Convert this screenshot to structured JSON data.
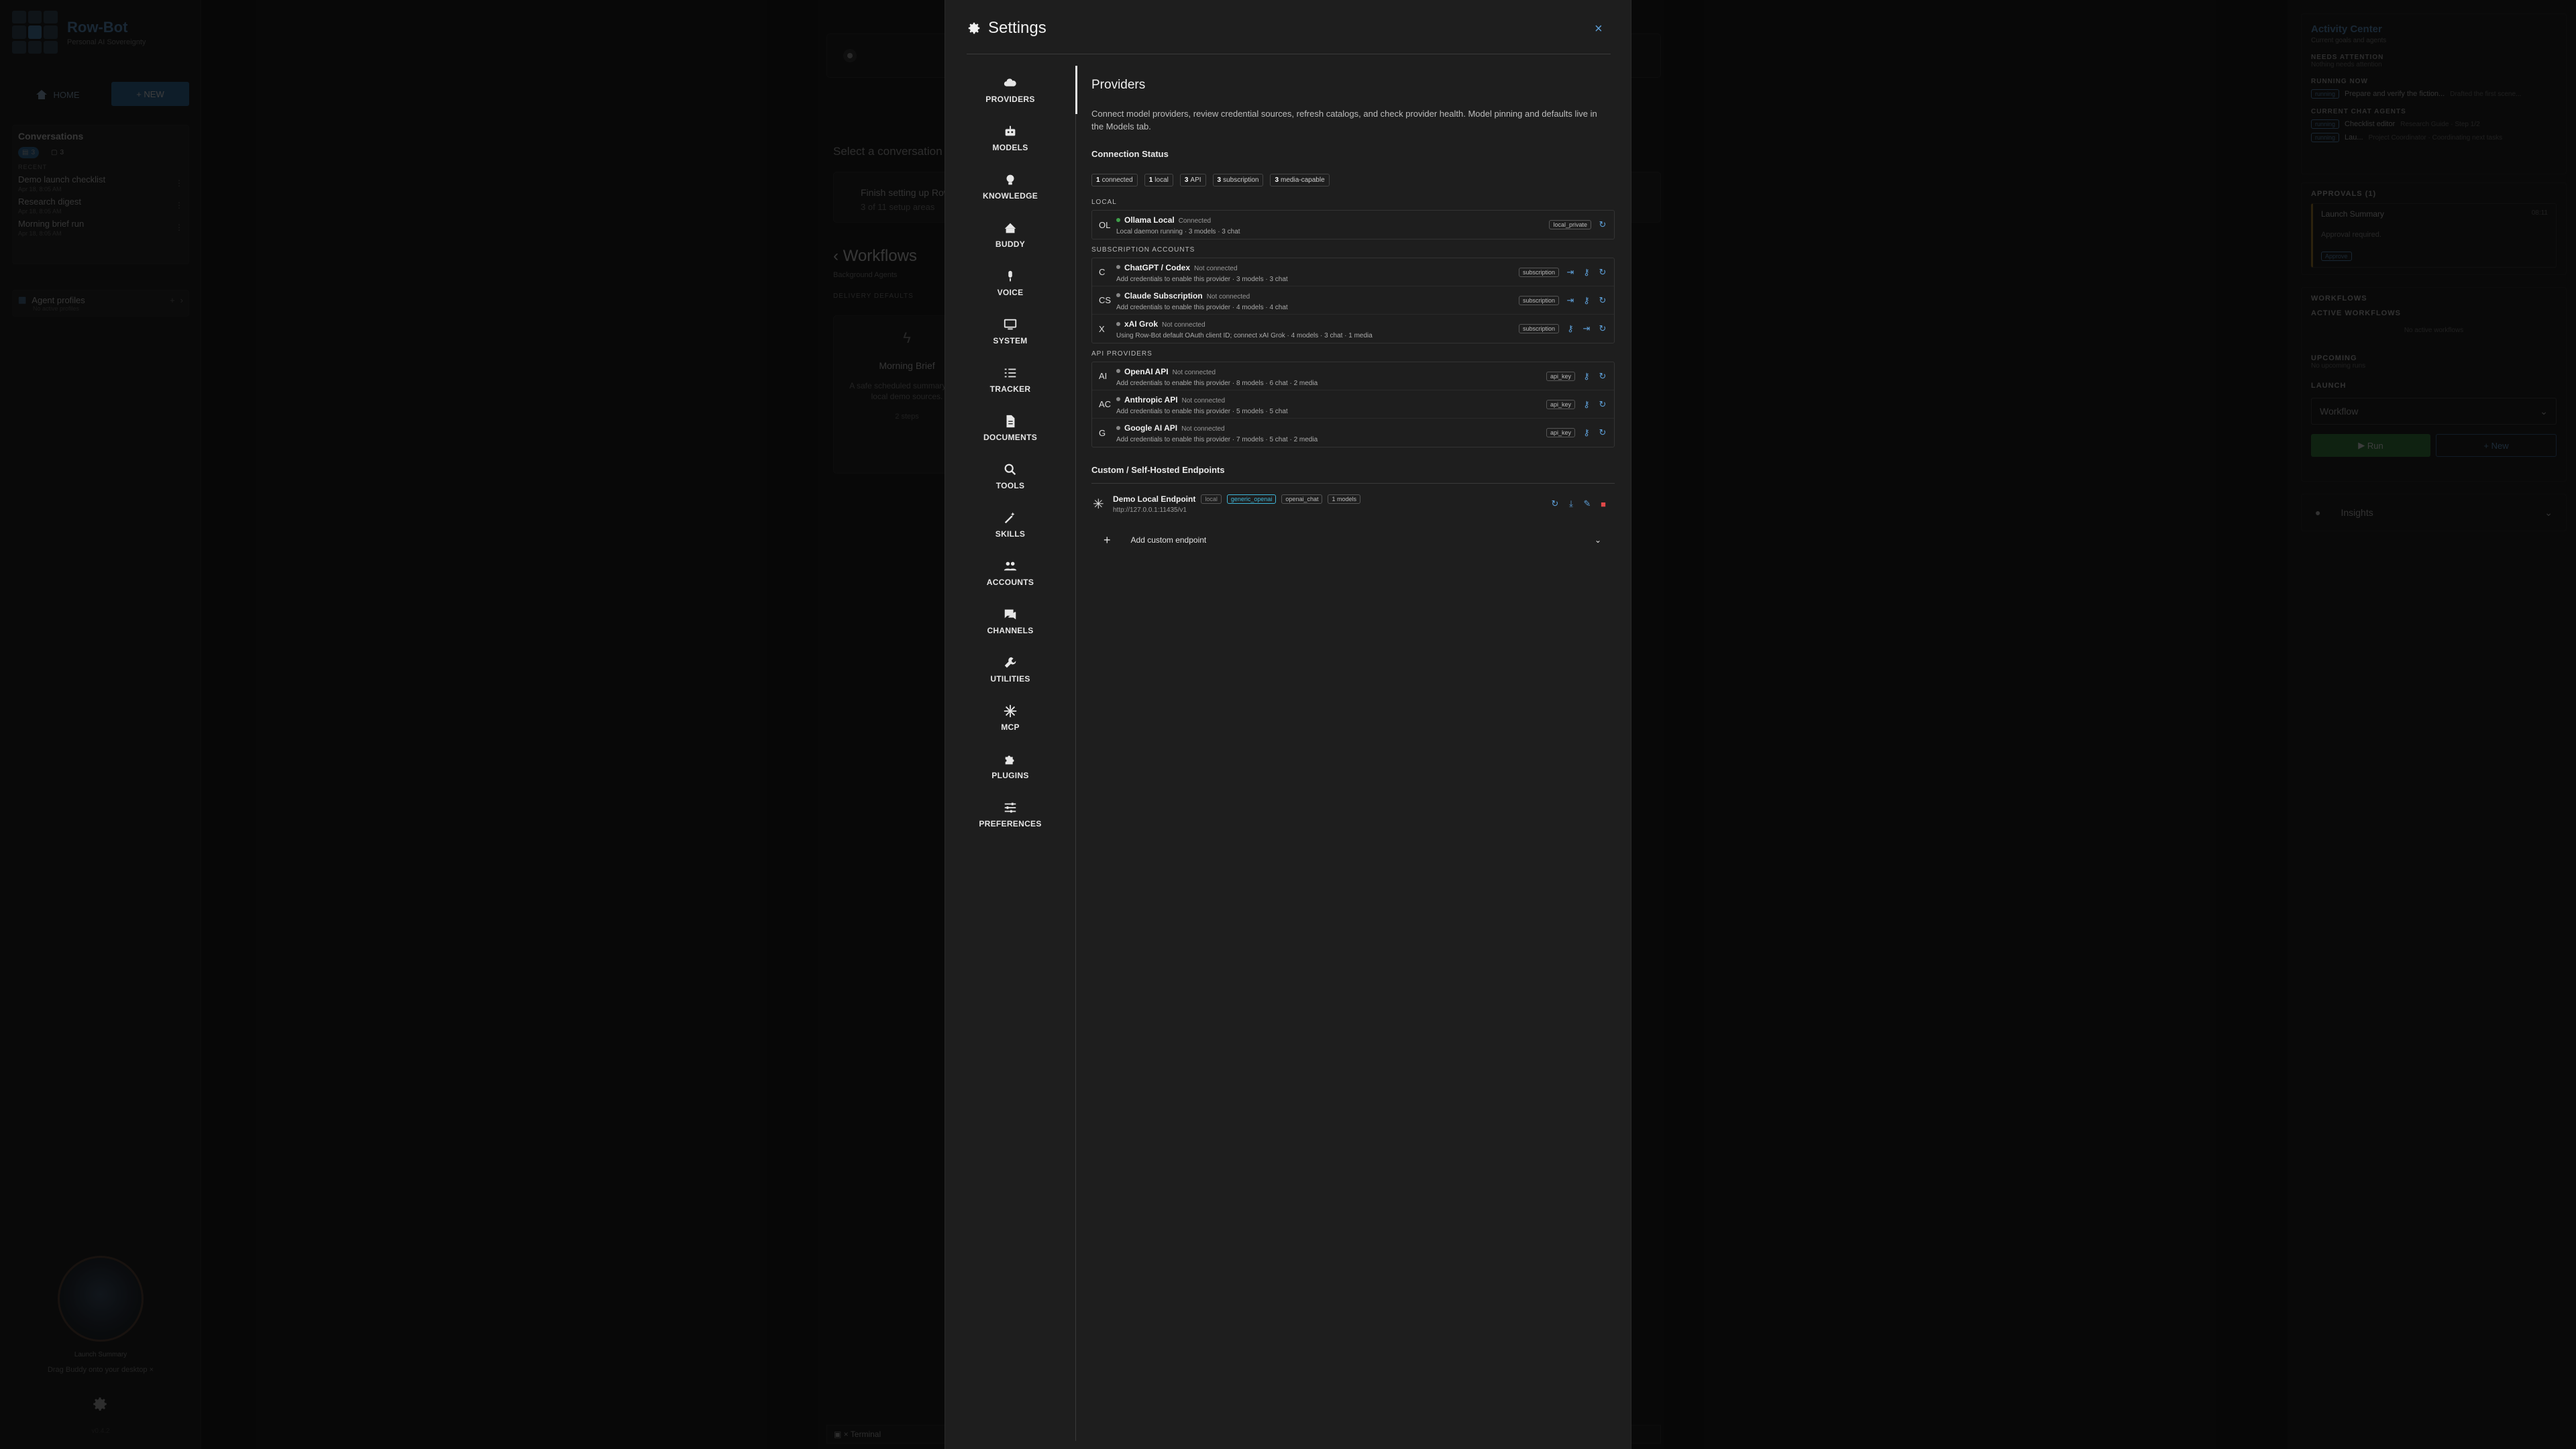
{
  "left": {
    "brand_title": "Row-Bot",
    "brand_sub": "Personal AI Sovereignty",
    "home_label": "HOME",
    "new_label": "+ NEW",
    "conversations_title": "Conversations",
    "conv_tab_count_1": "3",
    "conv_tab_count_2": "3",
    "recent_label": "RECENT",
    "conversations": [
      {
        "name": "Demo launch checklist",
        "time": "Apr 18, 8:05 AM"
      },
      {
        "name": "Research digest",
        "time": "Apr 18, 8:05 AM"
      },
      {
        "name": "Morning brief run",
        "time": "Apr 18, 8:05 AM"
      }
    ],
    "agent_profiles_title": "Agent profiles",
    "agent_profiles_sub": "No active profiles",
    "buddy_label": "Launch Summary",
    "buddy_hint": "Drag Buddy onto your desktop",
    "version": "v0.4.2"
  },
  "center": {
    "select_text": "Select a conversation",
    "setup_title": "Finish setting up Row-Bot",
    "setup_sub": "3 of 11 setup areas",
    "workflows_title": "Workflows",
    "workflows_sub": "Background Agents",
    "delivery_label": "DELIVERY DEFAULTS",
    "card_title": "Morning Brief",
    "card_desc": "A safe scheduled summary from local demo sources.",
    "card_steps": "2 steps",
    "terminal_label": "Terminal"
  },
  "right": {
    "activity_title": "Activity Center",
    "activity_sub": "Current goals and agents",
    "needs_attention": "NEEDS ATTENTION",
    "needs_attention_sub": "Nothing needs attention",
    "running_now": "RUNNING NOW",
    "running_pill": "running",
    "running_task": "Prepare and verify the fiction...",
    "running_meta": "Drafted the first scene...",
    "current_agents": "CURRENT CHAT AGENTS",
    "agents": [
      {
        "pill": "running",
        "name": "Checklist editor",
        "meta": "Research Guide · Step 1/2"
      },
      {
        "pill": "running",
        "name": "Lau...",
        "meta": "Project Coordinator · Coordinating next tasks"
      }
    ],
    "approvals_title": "APPROVALS (1)",
    "approval_name": "Launch Summary",
    "approval_time": "08:11",
    "approval_text": "Approval required.",
    "approve_label": "Approve",
    "workflows_label": "WORKFLOWS",
    "active_workflows": "ACTIVE WORKFLOWS",
    "no_active": "No active workflows",
    "upcoming_label": "UPCOMING",
    "upcoming_sub": "No upcoming runs",
    "launch_label": "LAUNCH",
    "workflow_select": "Workflow",
    "run_label": "Run",
    "new_label": "New",
    "insights_label": "Insights"
  },
  "modal": {
    "title": "Settings",
    "nav": [
      {
        "label": "PROVIDERS",
        "icon": "cloud-icon"
      },
      {
        "label": "MODELS",
        "icon": "robot-icon"
      },
      {
        "label": "KNOWLEDGE",
        "icon": "bulb-icon"
      },
      {
        "label": "BUDDY",
        "icon": "buddy-icon"
      },
      {
        "label": "VOICE",
        "icon": "mic-icon"
      },
      {
        "label": "SYSTEM",
        "icon": "monitor-icon"
      },
      {
        "label": "TRACKER",
        "icon": "checklist-icon"
      },
      {
        "label": "DOCUMENTS",
        "icon": "document-icon"
      },
      {
        "label": "TOOLS",
        "icon": "search-icon"
      },
      {
        "label": "SKILLS",
        "icon": "wand-icon"
      },
      {
        "label": "ACCOUNTS",
        "icon": "people-icon"
      },
      {
        "label": "CHANNELS",
        "icon": "chat-icon"
      },
      {
        "label": "UTILITIES",
        "icon": "wrench-icon"
      },
      {
        "label": "MCP",
        "icon": "hub-icon"
      },
      {
        "label": "PLUGINS",
        "icon": "puzzle-icon"
      },
      {
        "label": "PREFERENCES",
        "icon": "sliders-icon"
      }
    ],
    "content": {
      "title": "Providers",
      "description": "Connect model providers, review credential sources, refresh catalogs, and check provider health. Model pinning and defaults live in the Models tab.",
      "connection_status": "Connection Status",
      "chips": [
        {
          "n": "1",
          "label": "connected"
        },
        {
          "n": "1",
          "label": "local"
        },
        {
          "n": "3",
          "label": "API"
        },
        {
          "n": "3",
          "label": "subscription"
        },
        {
          "n": "3",
          "label": "media-capable"
        }
      ],
      "local_label": "LOCAL",
      "local": [
        {
          "abbr": "OL",
          "name": "Ollama Local",
          "status": "Connected",
          "desc": "Local daemon running · 3 models · 3 chat",
          "tag": "local_private"
        }
      ],
      "subscription_label": "SUBSCRIPTION ACCOUNTS",
      "subscription": [
        {
          "abbr": "C",
          "name": "ChatGPT / Codex",
          "status": "Not connected",
          "desc": "Add credentials to enable this provider · 3 models · 3 chat",
          "tag": "subscription"
        },
        {
          "abbr": "CS",
          "name": "Claude Subscription",
          "status": "Not connected",
          "desc": "Add credentials to enable this provider · 4 models · 4 chat",
          "tag": "subscription"
        },
        {
          "abbr": "X",
          "name": "xAI Grok",
          "status": "Not connected",
          "desc": "Using Row-Bot default OAuth client ID; connect xAI Grok · 4 models · 3 chat · 1 media",
          "tag": "subscription"
        }
      ],
      "api_label": "API PROVIDERS",
      "api": [
        {
          "abbr": "AI",
          "name": "OpenAI API",
          "status": "Not connected",
          "desc": "Add credentials to enable this provider · 8 models · 6 chat · 2 media",
          "tag": "api_key"
        },
        {
          "abbr": "AC",
          "name": "Anthropic API",
          "status": "Not connected",
          "desc": "Add credentials to enable this provider · 5 models · 5 chat",
          "tag": "api_key"
        },
        {
          "abbr": "G",
          "name": "Google AI API",
          "status": "Not connected",
          "desc": "Add credentials to enable this provider · 7 models · 5 chat · 2 media",
          "tag": "api_key"
        }
      ],
      "custom_title": "Custom / Self-Hosted Endpoints",
      "endpoint": {
        "name": "Demo Local Endpoint",
        "url": "http://127.0.0.1:11435/v1",
        "tags": [
          "local",
          "generic_openai",
          "openai_chat",
          "1 models"
        ]
      },
      "add_endpoint": "Add custom endpoint"
    }
  }
}
